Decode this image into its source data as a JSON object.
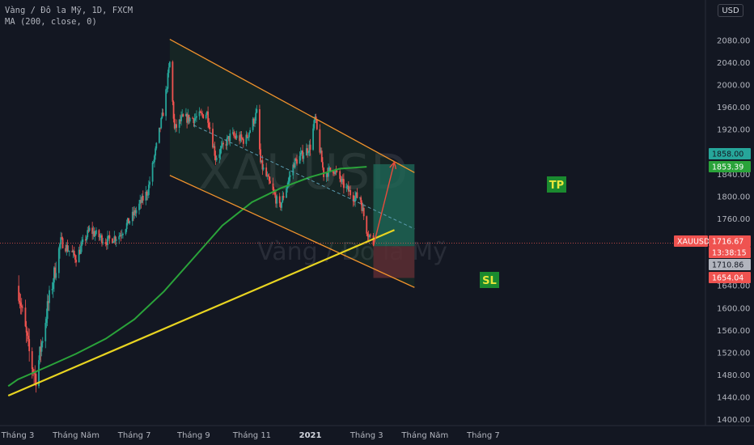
{
  "header": {
    "title_line": "Vàng / Đô la Mỹ, 1D, FXCM",
    "indicator_line": "MA (200, close, 0)",
    "currency_button": "USD"
  },
  "watermark": {
    "symbol": "XAUUSD",
    "name": "Vàng / Đô la Mỹ"
  },
  "colors": {
    "background": "#131722",
    "candle_up": "#26a69a",
    "candle_down": "#ef5350",
    "ma_line": "#2aa33a",
    "trendline": "#e8d421",
    "channel": "#f0922c",
    "target_zone": "#1f6b5a",
    "stop_zone": "#5c2c33",
    "arrow": "#e94b3c",
    "tp_label_bg": "#1b8a2f",
    "tp_label_text": "#e8e63b",
    "axis_text": "#b2b5be"
  },
  "price_tags": {
    "target": "1858.00",
    "ma": "1853.39",
    "symbol": "XAUUSD",
    "last": "1716.67",
    "countdown": "13:38:15",
    "entry": "1710.86",
    "stop": "1654.04"
  },
  "labels": {
    "tp": "TP",
    "sl": "SL"
  },
  "chart_data": {
    "type": "candlestick",
    "title": "Vàng / Đô la Mỹ, 1D, FXCM",
    "y_axis": {
      "ticks": [
        1400,
        1440,
        1480,
        1520,
        1560,
        1600,
        1640,
        1680,
        1720,
        1760,
        1800,
        1840,
        1880,
        1920,
        1960,
        2000,
        2040,
        2080
      ],
      "tick_labels": [
        "1400.00",
        "1440.00",
        "1480.00",
        "1520.00",
        "1560.00",
        "1600.00",
        "1640.00",
        "1680.00",
        "1720.00",
        "1760.00",
        "1800.00",
        "1840.00",
        "1880.00",
        "1920.00",
        "1960.00",
        "2000.00",
        "2040.00",
        "2080.00"
      ],
      "range": [
        1392,
        2112
      ]
    },
    "x_axis": {
      "labels": [
        "Tháng 3",
        "Tháng Năm",
        "Tháng 7",
        "Tháng 9",
        "Tháng 11",
        "2021",
        "Tháng 3",
        "Tháng Năm",
        "Tháng 7"
      ],
      "bold_label": "2021",
      "range": [
        "2020-03-01",
        "2021-08-15"
      ]
    },
    "series": [
      {
        "name": "MA (200, close, 0)",
        "x": [
          "2020-03-01",
          "2020-04-01",
          "2020-05-01",
          "2020-06-01",
          "2020-07-01",
          "2020-08-01",
          "2020-09-01",
          "2020-10-01",
          "2020-11-01",
          "2020-12-01",
          "2021-01-01",
          "2021-02-01",
          "2021-03-01"
        ],
        "values": [
          1472,
          1495,
          1518,
          1545,
          1580,
          1630,
          1690,
          1748,
          1790,
          1815,
          1835,
          1850,
          1853.39
        ]
      }
    ],
    "ohlc_path": {
      "x": [
        "2020-03-01",
        "2020-03-15",
        "2020-03-20",
        "2020-04-01",
        "2020-04-15",
        "2020-05-01",
        "2020-05-15",
        "2020-06-01",
        "2020-06-15",
        "2020-07-01",
        "2020-07-15",
        "2020-08-01",
        "2020-08-07",
        "2020-08-12",
        "2020-08-20",
        "2020-09-01",
        "2020-09-15",
        "2020-09-24",
        "2020-10-10",
        "2020-10-25",
        "2020-11-06",
        "2020-11-10",
        "2020-11-30",
        "2020-12-15",
        "2021-01-01",
        "2021-01-06",
        "2021-01-15",
        "2021-01-25",
        "2021-02-05",
        "2021-02-15",
        "2021-02-22",
        "2021-03-01",
        "2021-03-08"
      ],
      "close": [
        1640,
        1500,
        1475,
        1600,
        1720,
        1690,
        1740,
        1720,
        1730,
        1770,
        1810,
        1960,
        2040,
        1920,
        1940,
        1940,
        1950,
        1870,
        1910,
        1900,
        1950,
        1860,
        1780,
        1860,
        1890,
        1940,
        1840,
        1850,
        1820,
        1800,
        1800,
        1740,
        1716.67
      ]
    },
    "drawings": {
      "channel_upper": [
        [
          "2020-08-07",
          2082
        ],
        [
          "2021-04-20",
          1843
        ]
      ],
      "channel_lower": [
        [
          "2020-08-07",
          1838
        ],
        [
          "2021-04-20",
          1637
        ]
      ],
      "channel_mid": [
        [
          "2020-09-01",
          1928
        ],
        [
          "2021-04-20",
          1742
        ]
      ],
      "trendline": [
        [
          "2020-02-20",
          1443
        ],
        [
          "2021-03-30",
          1740
        ]
      ],
      "long_position": {
        "start": "2021-03-08",
        "end": "2021-04-20",
        "entry": 1710.86,
        "target": 1858.0,
        "stop": 1654.04
      },
      "arrow": [
        [
          "2021-03-08",
          1711
        ],
        [
          "2021-03-30",
          1862
        ]
      ]
    }
  }
}
